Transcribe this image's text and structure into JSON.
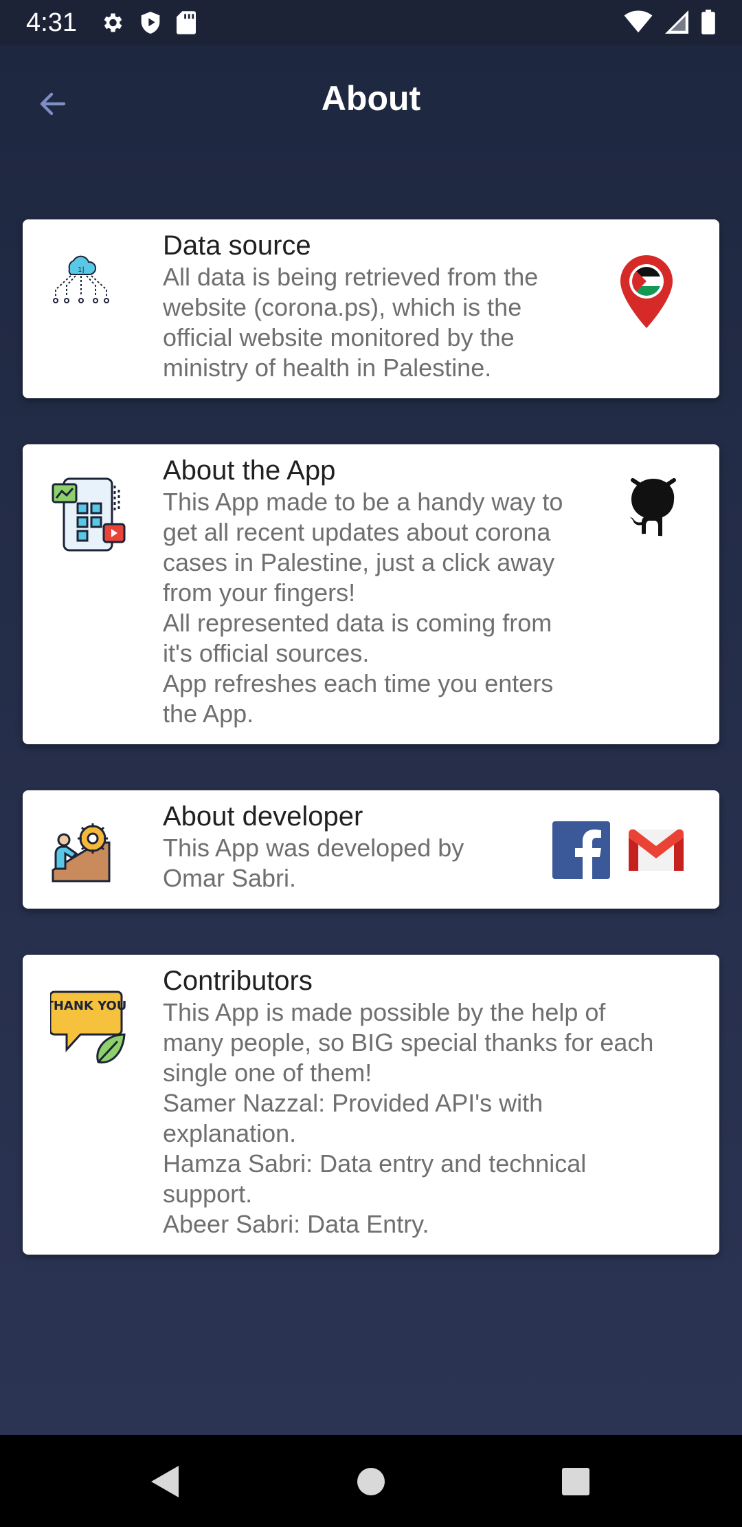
{
  "status_bar": {
    "time": "4:31",
    "icons": [
      "settings-icon",
      "shield-play-icon",
      "sd-card-icon",
      "wifi-icon",
      "signal-icon",
      "battery-icon"
    ]
  },
  "header": {
    "title": "About",
    "back_icon": "arrow-back-icon"
  },
  "cards": [
    {
      "title": "Data source",
      "body": "All data is being retrieved from the\nwebsite (corona.ps), which is the\nofficial website monitored by the\nministry of health in Palestine.",
      "icon": "cloud-network-icon",
      "action_icon": "palestine-location-pin-icon"
    },
    {
      "title": "About the App",
      "body": "This App made to be a handy way to\nget all recent updates about corona\ncases in Palestine, just a click away\nfrom your fingers!\nAll represented data is coming from\nit's official sources.\nApp refreshes each time you enters\nthe App.",
      "icon": "app-dashboard-icon",
      "action_icon": "github-icon"
    },
    {
      "title": "About developer",
      "body": "This App was developed by\nOmar Sabri.",
      "icon": "developer-gear-icon",
      "action_icons": [
        "facebook-icon",
        "gmail-icon"
      ]
    },
    {
      "title": "Contributors",
      "body": "This App is made possible by the help of\nmany people, so BIG special thanks for each\nsingle one of them!\nSamer Nazzal: Provided API's with\nexplanation.\nHamza Sabri: Data entry and technical\nsupport.\nAbeer Sabri: Data Entry.",
      "icon": "thank-you-bubble-icon",
      "icon_text": "THANK YOU"
    }
  ],
  "colors": {
    "background": "#2a3350",
    "card": "#ffffff",
    "facebook": "#3b5998",
    "gmail_red": "#ea4335",
    "pin_red": "#d62a28"
  },
  "nav_bar": [
    "back-triangle-icon",
    "home-circle-icon",
    "recents-square-icon"
  ]
}
